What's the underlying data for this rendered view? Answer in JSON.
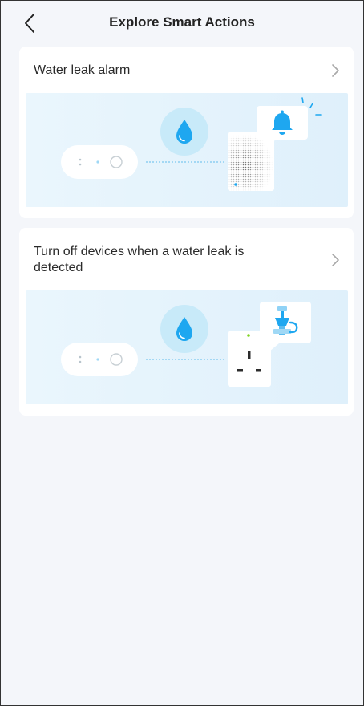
{
  "header": {
    "title": "Explore Smart Actions",
    "back_icon": "chevron-left-icon"
  },
  "cards": [
    {
      "title": "Water leak alarm",
      "illustration": "sensor-to-siren",
      "icons": [
        "water-drop-icon",
        "bell-icon",
        "chevron-right-icon"
      ]
    },
    {
      "title": "Turn off devices when a water leak is detected",
      "illustration": "sensor-to-plug-valve",
      "icons": [
        "water-drop-icon",
        "valve-icon",
        "chevron-right-icon"
      ]
    }
  ],
  "colors": {
    "background": "#f4f6fa",
    "card": "#ffffff",
    "illustration_bg": "#e3f3fc",
    "accent_blue": "#1ea7f0",
    "drop_circle": "#c8eaf9",
    "led_green": "#7ed321"
  }
}
